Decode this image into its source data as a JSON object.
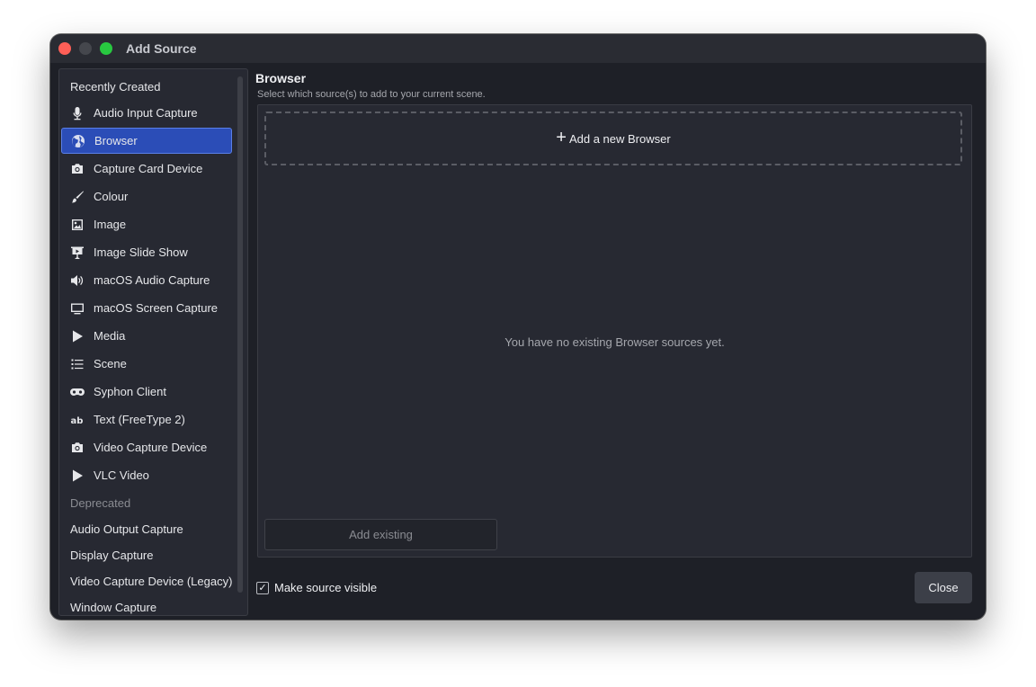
{
  "window": {
    "title": "Add Source"
  },
  "sidebar": {
    "recently_created": "Recently Created",
    "items": [
      {
        "label": "Audio Input Capture",
        "icon": "microphone-icon"
      },
      {
        "label": "Browser",
        "icon": "globe-icon",
        "selected": true
      },
      {
        "label": "Capture Card Device",
        "icon": "camera-icon"
      },
      {
        "label": "Colour",
        "icon": "paintbrush-icon"
      },
      {
        "label": "Image",
        "icon": "image-icon"
      },
      {
        "label": "Image Slide Show",
        "icon": "slideshow-icon"
      },
      {
        "label": "macOS Audio Capture",
        "icon": "speaker-icon"
      },
      {
        "label": "macOS Screen Capture",
        "icon": "monitor-icon"
      },
      {
        "label": "Media",
        "icon": "play-icon"
      },
      {
        "label": "Scene",
        "icon": "list-icon"
      },
      {
        "label": "Syphon Client",
        "icon": "gamepad-icon"
      },
      {
        "label": "Text (FreeType 2)",
        "icon": "text-icon"
      },
      {
        "label": "Video Capture Device",
        "icon": "camera-icon"
      },
      {
        "label": "VLC Video",
        "icon": "play-icon"
      }
    ],
    "deprecated": "Deprecated",
    "deprecated_items": [
      "Audio Output Capture",
      "Display Capture",
      "Video Capture Device (Legacy)",
      "Window Capture"
    ]
  },
  "main": {
    "heading": "Browser",
    "subtitle": "Select which source(s) to add to your current scene.",
    "add_new_label": "Add a new Browser",
    "add_new_icon": "plus-icon",
    "empty_message": "You have no existing Browser sources yet.",
    "add_existing_label": "Add existing"
  },
  "footer": {
    "make_visible_label": "Make source visible",
    "make_visible_checked": true,
    "close_label": "Close"
  },
  "colors": {
    "selected": "#2b4db7",
    "window_bg": "#1e2027",
    "panel_bg": "#272932"
  }
}
